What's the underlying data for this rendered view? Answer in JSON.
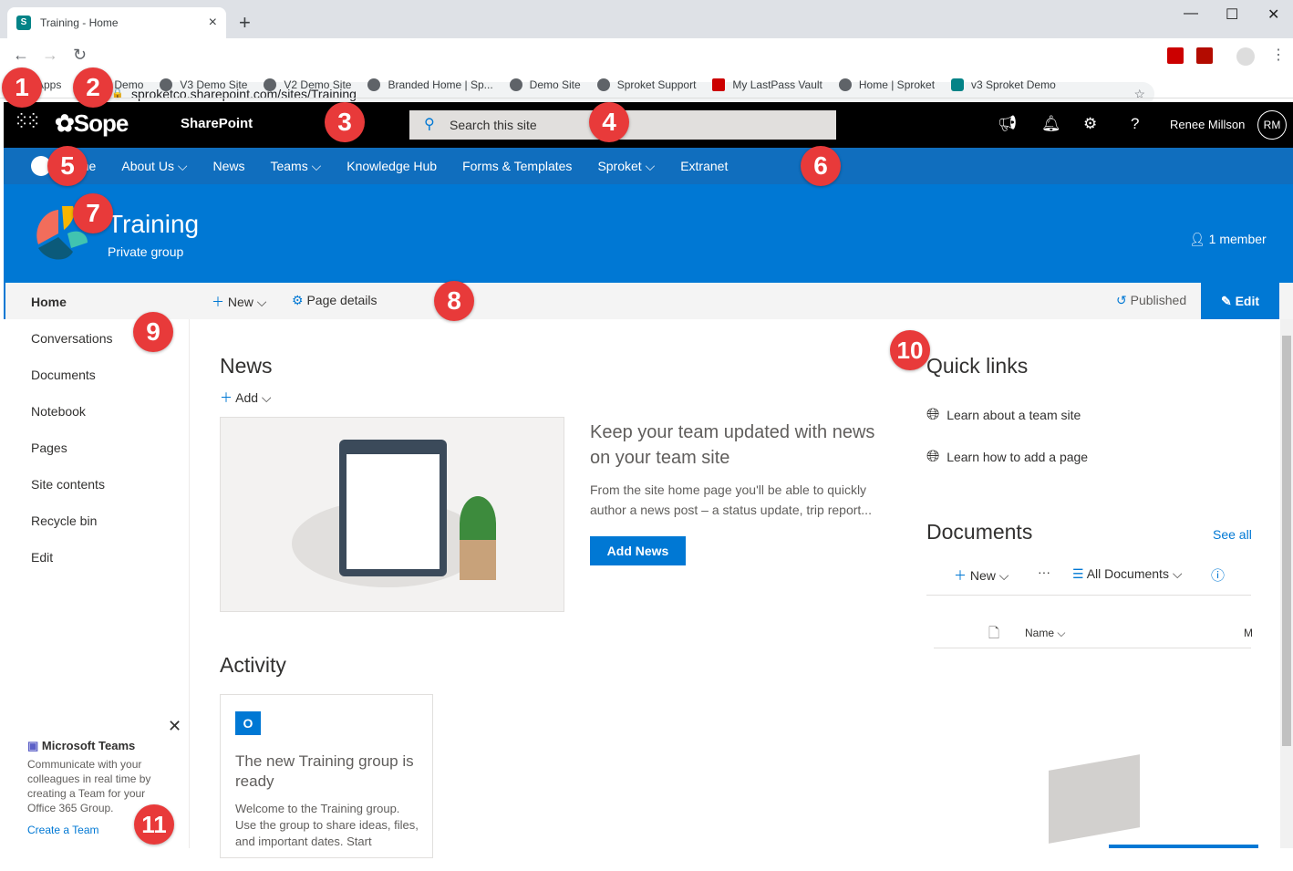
{
  "browser": {
    "tab_title": "Training - Home",
    "url": "sproketco.sharepoint.com/sites/Training",
    "bookmarks": [
      "Apps",
      "Demo",
      "V3 Demo Site",
      "V2 Demo Site",
      "Branded Home | Sp...",
      "Demo Site",
      "Sproket Support",
      "My LastPass Vault",
      "Home | Sproket",
      "v3 Sproket Demo"
    ]
  },
  "suite": {
    "logo": "Sope",
    "app": "SharePoint",
    "search_placeholder": "Search this site",
    "user": "Renee Millson",
    "initials": "RM"
  },
  "hubnav": {
    "items": [
      "Home",
      "About Us",
      "News",
      "Teams",
      "Knowledge Hub",
      "Forms & Templates",
      "Sproket",
      "Extranet"
    ]
  },
  "site": {
    "title": "Training",
    "subtitle": "Private group",
    "members": "1 member"
  },
  "leftnav": {
    "items": [
      "Home",
      "Conversations",
      "Documents",
      "Notebook",
      "Pages",
      "Site contents",
      "Recycle bin",
      "Edit"
    ]
  },
  "cmdbar": {
    "new": "New",
    "page_details": "Page details",
    "status": "Published",
    "edit": "Edit"
  },
  "news": {
    "title": "News",
    "add": "Add",
    "headline": "Keep your team updated with news on your team site",
    "body": "From the site home page you'll be able to quickly author a news post – a status update, trip report...",
    "button": "Add News"
  },
  "activity": {
    "title": "Activity",
    "card_title": "The new Training group is ready",
    "card_body": "Welcome to the Training group. Use the group to share ideas, files, and important dates. Start"
  },
  "quicklinks": {
    "title": "Quick links",
    "items": [
      "Learn about a team site",
      "Learn how to add a page"
    ]
  },
  "documents": {
    "title": "Documents",
    "see_all": "See all",
    "new": "New",
    "more": "···",
    "view": "All Documents",
    "col_name": "Name",
    "col_modified": "M"
  },
  "teams_panel": {
    "title": "Microsoft Teams",
    "body": "Communicate with your colleagues in real time by creating a Team for your Office 365 Group.",
    "link": "Create a Team"
  },
  "annotations": [
    "1",
    "2",
    "3",
    "4",
    "5",
    "6",
    "7",
    "8",
    "9",
    "10",
    "11"
  ],
  "colors": {
    "suite": "#000000",
    "hubnav": "#106ebe",
    "header": "#0078d4",
    "annotation": "#e83a3a"
  }
}
